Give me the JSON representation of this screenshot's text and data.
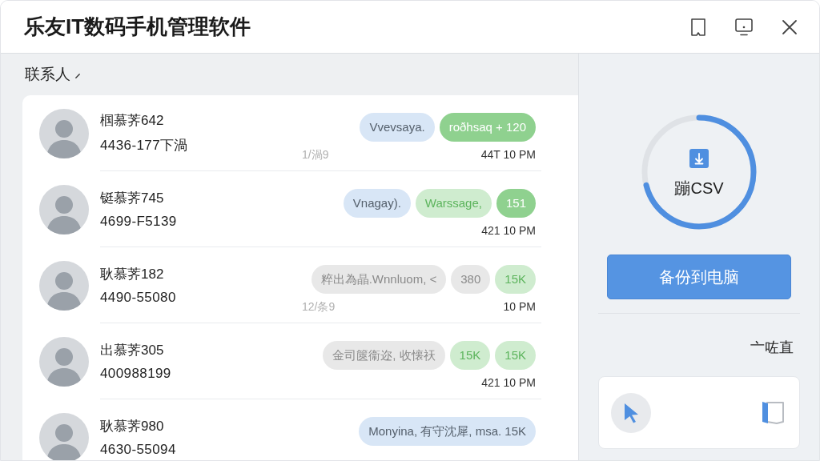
{
  "window": {
    "title": "乐友IT数码手机管理软件"
  },
  "contacts": {
    "heading": "联系人",
    "rows": [
      {
        "name": "椢慕荠642",
        "phone": "4436-177下渦",
        "bubbles": [
          {
            "kind": "incoming",
            "text": "Vvevsaya."
          },
          {
            "kind": "outgoing",
            "text": "roðhsaq + 120"
          }
        ],
        "time_left": "1/渦9",
        "time_right": "44T 10 PM"
      },
      {
        "name": "铤慕荠745",
        "phone": "4699-F5139",
        "bubbles": [
          {
            "kind": "incoming",
            "text": "Vnagay)."
          },
          {
            "kind": "pale",
            "text": "Warssage,"
          },
          {
            "kind": "outgoing",
            "text": "151"
          }
        ],
        "time_right": "421 10 PM"
      },
      {
        "name": "耿慕荠182",
        "phone": "4490-55080",
        "bubbles": [
          {
            "kind": "neutral",
            "text": "粹出為晶.Wnnluom, <"
          },
          {
            "kind": "neutral",
            "text": "380"
          },
          {
            "kind": "pale",
            "text": "15K"
          }
        ],
        "time_left": "12/条9",
        "time_right": "10 PM"
      },
      {
        "name": "出慕荠305",
        "phone": "400988199",
        "bubbles": [
          {
            "kind": "neutral",
            "text": "金司篋衞迩, 收懐祆"
          },
          {
            "kind": "pale",
            "text": "15K"
          },
          {
            "kind": "pale",
            "text": "15K"
          }
        ],
        "time_right": "421 10 PM"
      },
      {
        "name": "耿慕荠980",
        "phone": "4630-55094",
        "bubbles": [
          {
            "kind": "incoming",
            "text": "Monyina, 有守沈犀, msa. 15K"
          }
        ]
      }
    ]
  },
  "export": {
    "level": 0.71,
    "label": "蹦CSV",
    "button": "备份到电脑",
    "caption": "亠咗直"
  }
}
